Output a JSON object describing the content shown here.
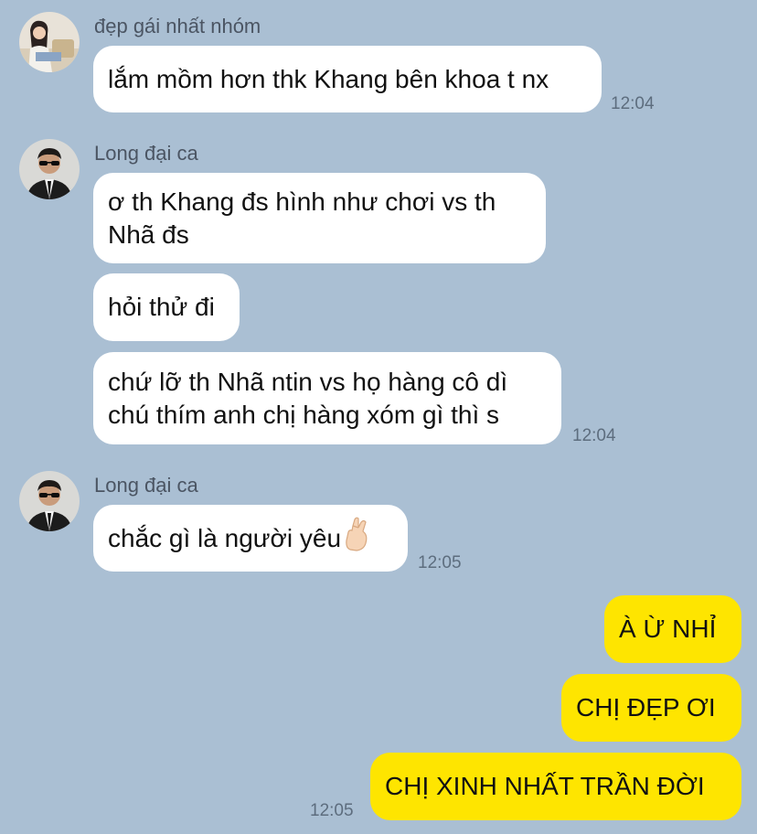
{
  "messages": {
    "group1": {
      "sender": "đẹp gái nhất nhóm",
      "avatar_icon": "girl-avatar-photo",
      "bubbles": [
        "lắm mồm hơn thk Khang bên khoa t nx"
      ],
      "time": "12:04"
    },
    "group2": {
      "sender": "Long đại ca",
      "avatar_icon": "man-sunglasses-avatar-photo",
      "bubbles": [
        "ơ th Khang đs hình như chơi vs th Nhã đs",
        "hỏi thử đi",
        "chứ lỡ th Nhã ntin vs họ hàng cô dì chú thím anh chị hàng xóm gì thì s"
      ],
      "time": "12:04"
    },
    "group3": {
      "sender": "Long đại ca",
      "avatar_icon": "man-sunglasses-avatar-photo",
      "bubbles": [
        "chắc gì là người yêu"
      ],
      "emoji": "crossed-fingers-icon",
      "time": "12:05"
    },
    "outgoing": {
      "bubbles": [
        "À Ừ NHỈ",
        "CHỊ ĐẸP ƠI",
        "CHỊ XINH NHẤT TRẦN ĐỜI"
      ],
      "time": "12:05"
    }
  },
  "colors": {
    "background": "#aabfd3",
    "incoming_bubble": "#ffffff",
    "outgoing_bubble": "#fee500"
  }
}
